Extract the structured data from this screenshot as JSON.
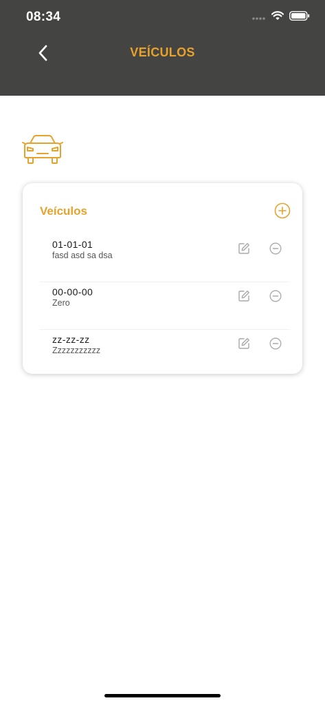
{
  "status_bar": {
    "time": "08:34",
    "icons": [
      "signal-dots-icon",
      "wifi-icon",
      "battery-icon"
    ]
  },
  "header": {
    "title": "VEÍCULOS",
    "back_icon": "chevron-left-icon"
  },
  "colors": {
    "header_bg": "#444442",
    "accent": "#e7a22b",
    "icon_gray": "#a8a8a8"
  },
  "page_icon": "car-icon",
  "card": {
    "title": "Veículos",
    "add_icon": "plus-circle-icon",
    "vehicles": [
      {
        "plate": "01-01-01",
        "description": "fasd asd sa dsa"
      },
      {
        "plate": "00-00-00",
        "description": "Zero"
      },
      {
        "plate": "zz-zz-zz",
        "description": "Zzzzzzzzzzz"
      }
    ],
    "row_icons": [
      "edit-icon",
      "minus-circle-icon"
    ]
  }
}
